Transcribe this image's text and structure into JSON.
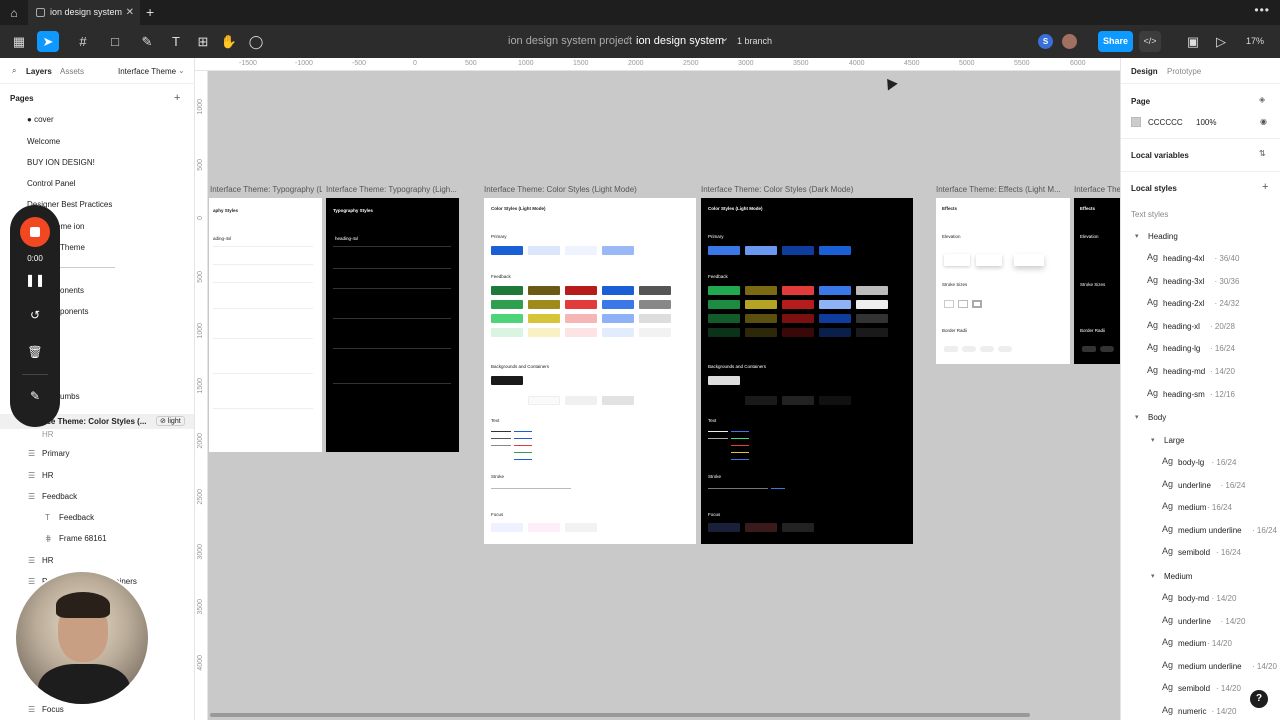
{
  "tabbar": {
    "tab_title": "ion design system",
    "close": "✕",
    "new_tab": "+",
    "more": "•••"
  },
  "toolbar": {
    "project": "ion design system project",
    "separator": "/",
    "file": "ion design system",
    "file_chevron": "⌄",
    "branch": "1 branch",
    "avatar_letter": "S",
    "share_label": "Share",
    "zoom": "17%"
  },
  "left_panel": {
    "tab_layers": "Layers",
    "tab_assets": "Assets",
    "page_selector": "Interface Theme",
    "pages_heading": "Pages",
    "pages": [
      "cover",
      "Welcome",
      "BUY ION DESIGN!",
      "Control Panel",
      "Designer Best Practices",
      "eme ion",
      "Theme",
      "onents",
      "ponents",
      "umbs"
    ],
    "layer_frame": "ace Theme: Color Styles (...",
    "layer_badge": "light",
    "layers": [
      "HR",
      "Primary",
      "HR",
      "Feedback",
      "Feedback",
      "Frame 68161",
      "HR",
      "P",
      "ontainers",
      "Focus"
    ]
  },
  "recorder": {
    "time": "0:00"
  },
  "rulers": {
    "top": [
      "-1500",
      "-1000",
      "-500",
      "0",
      "500",
      "1000",
      "1500",
      "2000",
      "2500",
      "3000",
      "3500",
      "4000",
      "4500",
      "5000",
      "5500",
      "6000"
    ],
    "left": [
      "1000",
      "500",
      "0",
      "500",
      "1000",
      "1500",
      "2000",
      "2500",
      "3000",
      "3500",
      "4000"
    ]
  },
  "canvas": {
    "labels": [
      "Interface Theme: Typography (Ligh...",
      "Interface Theme: Typography (Ligh...",
      "Interface Theme: Color Styles (Light Mode)",
      "Interface Theme: Color Styles (Dark Mode)",
      "Interface Theme: Effects (Light M...",
      "Interface The"
    ],
    "typo_light": {
      "title": "aphy Styles",
      "item": "ading-4xl"
    },
    "typo_dark": {
      "title": "Typography Styles",
      "item": "heading-4xl"
    },
    "color_light": {
      "title": "Color Styles (Light Mode)",
      "sections": [
        "Primary",
        "Feedback",
        "Backgrounds and Containers",
        "Text",
        "Stroke",
        "Focus"
      ]
    },
    "color_dark": {
      "title": "Color Styles (Light Mode)",
      "sections": [
        "Primary",
        "Feedback",
        "Backgrounds and Containers",
        "Text",
        "Stroke",
        "Focus"
      ]
    },
    "effects_light": {
      "title": "Effects",
      "sections": [
        "Elevation",
        "Stroke Sizes",
        "Border Radii"
      ]
    },
    "effects_dark": {
      "title": "Effects",
      "sections": [
        "Elevation",
        "Stroke Sizes",
        "Border Radii"
      ]
    }
  },
  "colors": {
    "swatch_rows_light": [
      [
        "#1a5fd6",
        "#dbe6fb",
        "#eef3fd",
        "#9ab8f5"
      ],
      [
        "#1f7a3a",
        "#6b5a14",
        "#b71c1c",
        "#1a5fd6",
        "#555555"
      ],
      [
        "#2e9e4f",
        "#a08a1c",
        "#e23b3b",
        "#3a78e8",
        "#888888"
      ],
      [
        "#4dd47a",
        "#d6c637",
        "#f7b6b6",
        "#8fb1f5",
        "#dddddd"
      ],
      [
        "#d9f5e2",
        "#f8f1c4",
        "#fde3e3",
        "#e3ecfd",
        "#f2f2f2"
      ]
    ],
    "swatch_rows_dark": [
      [
        "#3a78e8",
        "#6a98f0",
        "#0e3d9e",
        "#1a5fd6"
      ],
      [
        "#22a84f",
        "#7a6a14",
        "#e23b3b",
        "#3a78e8",
        "#bbbbbb"
      ],
      [
        "#1c8c42",
        "#b5a322",
        "#b71c1c",
        "#8fb1f5",
        "#eeeeee"
      ],
      [
        "#125c2c",
        "#5c5010",
        "#7a1010",
        "#0e3d9e",
        "#333333"
      ],
      [
        "#0b331a",
        "#2e280a",
        "#3a0808",
        "#0a1f4a",
        "#1a1a1a"
      ]
    ]
  },
  "right_panel": {
    "tab_design": "Design",
    "tab_prototype": "Prototype",
    "page_heading": "Page",
    "page_color": "CCCCCC",
    "page_opacity": "100%",
    "local_variables": "Local variables",
    "local_styles": "Local styles",
    "text_styles": "Text styles",
    "heading_group": "Heading",
    "heading_styles": [
      {
        "name": "heading-4xl",
        "meta": "· 36/40"
      },
      {
        "name": "heading-3xl",
        "meta": "· 30/36"
      },
      {
        "name": "heading-2xl",
        "meta": "· 24/32"
      },
      {
        "name": "heading-xl",
        "meta": "· 20/28"
      },
      {
        "name": "heading-lg",
        "meta": "· 16/24"
      },
      {
        "name": "heading-md",
        "meta": "· 14/20"
      },
      {
        "name": "heading-sm",
        "meta": "· 12/16"
      }
    ],
    "body_group": "Body",
    "large_group": "Large",
    "large_styles": [
      {
        "name": "body-lg",
        "meta": "· 16/24"
      },
      {
        "name": "underline",
        "meta": "· 16/24"
      },
      {
        "name": "medium",
        "meta": "· 16/24"
      },
      {
        "name": "medium underline",
        "meta": "· 16/24"
      },
      {
        "name": "semibold",
        "meta": "· 16/24"
      }
    ],
    "medium_group": "Medium",
    "medium_styles": [
      {
        "name": "body-md",
        "meta": "· 14/20"
      },
      {
        "name": "underline",
        "meta": "· 14/20"
      },
      {
        "name": "medium",
        "meta": "· 14/20"
      },
      {
        "name": "medium underline",
        "meta": "· 14/20"
      },
      {
        "name": "semibold",
        "meta": "· 14/20"
      },
      {
        "name": "numeric",
        "meta": "· 14/20"
      }
    ],
    "ag": "Ag"
  },
  "help": "?"
}
